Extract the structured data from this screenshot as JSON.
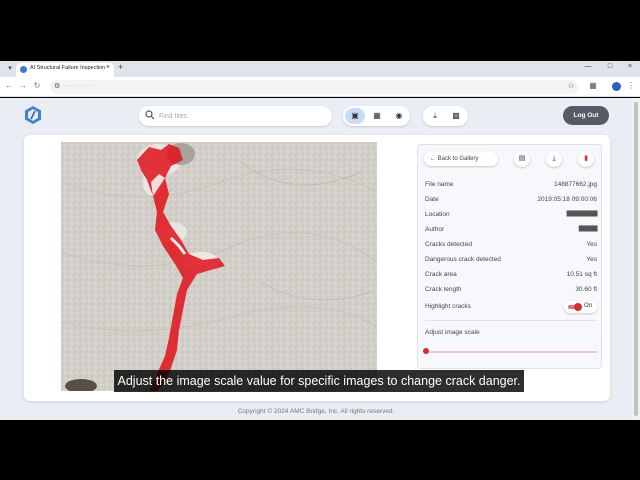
{
  "browser": {
    "tab_title": "AI Structural Failure Inspection",
    "url": "············"
  },
  "header": {
    "search_placeholder": "Find files",
    "logout_label": "Log Out"
  },
  "panel": {
    "back_label": "Back to Gallery",
    "fields": [
      {
        "label": "File name",
        "value": "148877662.jpg"
      },
      {
        "label": "Date",
        "value": "2019:05:18 09:00:06"
      },
      {
        "label": "Location",
        "value": "██████████"
      },
      {
        "label": "Author",
        "value": "██████"
      },
      {
        "label": "Cracks detected",
        "value": "Yes"
      },
      {
        "label": "Dangerous crack detected",
        "value": "Yes"
      },
      {
        "label": "Crack area",
        "value": "10.51 sq ft"
      },
      {
        "label": "Crack length",
        "value": "30.60 ft"
      }
    ],
    "highlight_label": "Highlight cracks",
    "highlight_state": "On",
    "scale_label": "Adjust image scale",
    "scale_value": 0
  },
  "footer": {
    "copyright": "Copyright © 2024 AMC Bridge, Inc. All rights reserved."
  },
  "caption": {
    "text": "Adjust the image scale value for specific images to change crack danger."
  },
  "colors": {
    "accent_red": "#d32f2f",
    "crack_overlay": "#e0101a",
    "logout_bg": "#555c66",
    "active_seg": "#c8dcf6"
  }
}
